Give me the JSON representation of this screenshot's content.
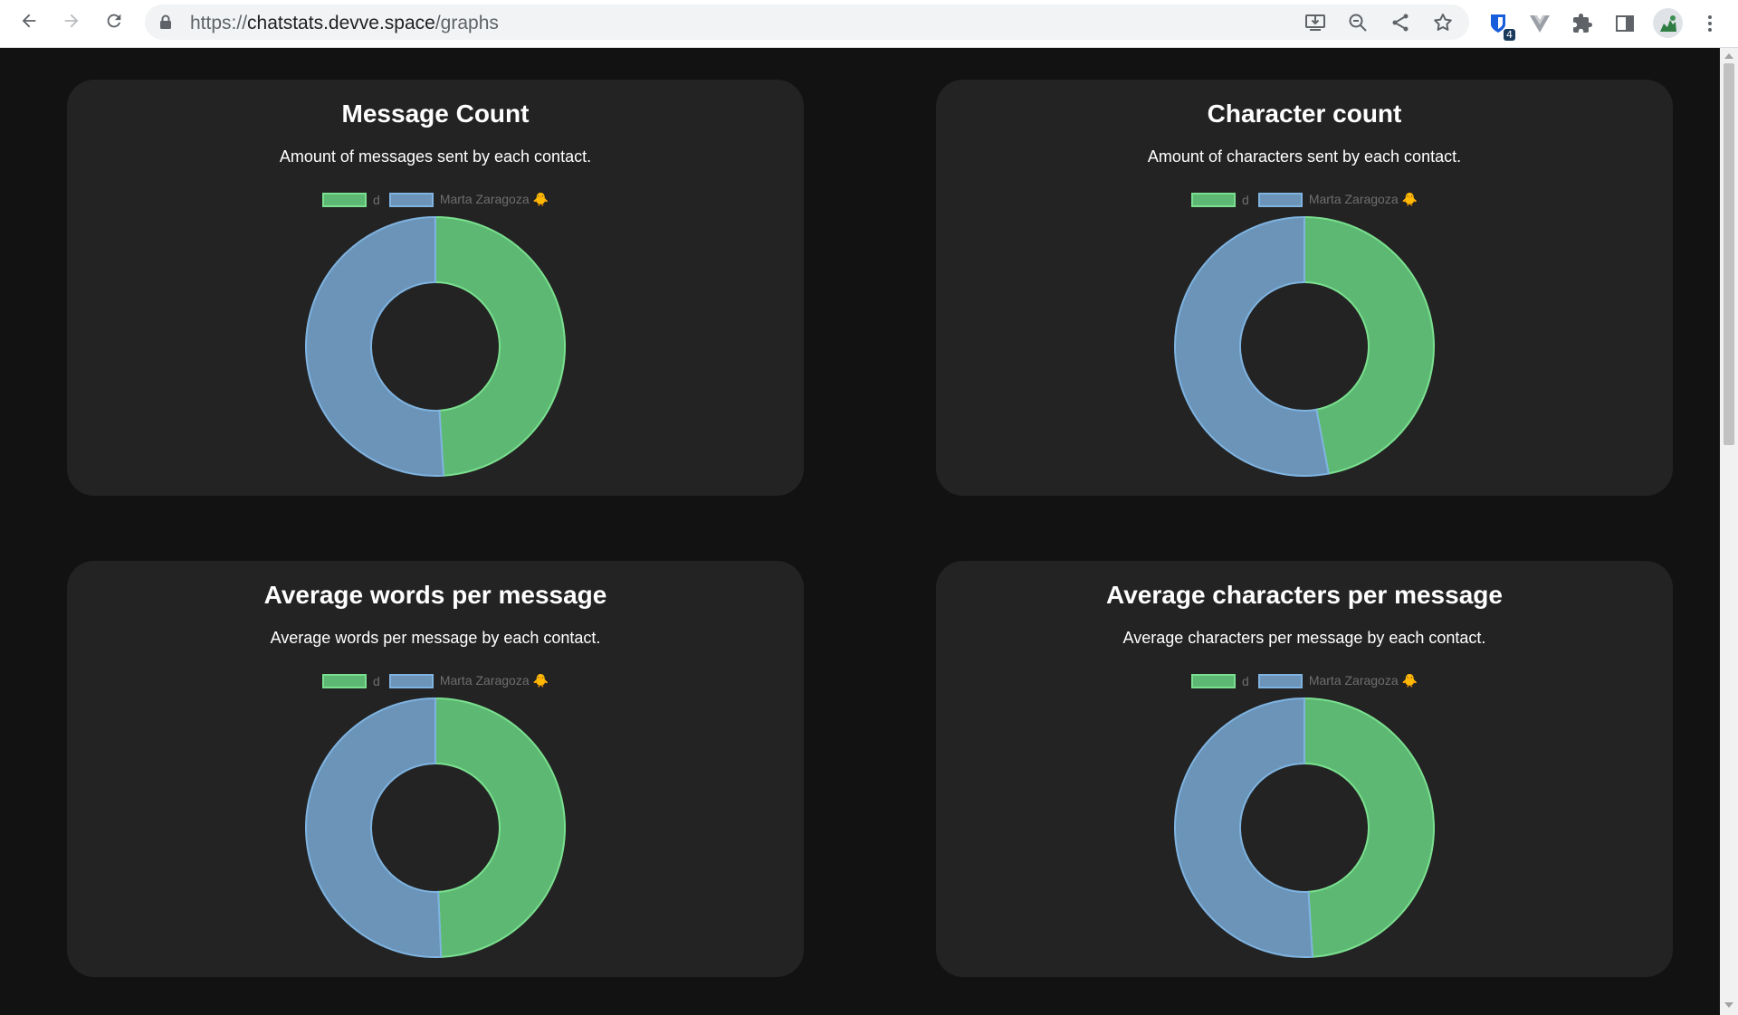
{
  "browser": {
    "url_prefix": "https://",
    "url_host": "chatstats.devve.space",
    "url_path": "/graphs",
    "extension_badge": "4"
  },
  "colors": {
    "page_bg": "#121212",
    "card_bg": "#232323",
    "series_d": "#5cb872",
    "series_d_border": "#7ae08f",
    "series_marta": "#6b94b8",
    "series_marta_border": "#7fb3e0"
  },
  "chart_data": [
    {
      "type": "pie",
      "title": "Message Count",
      "subtitle": "Amount of messages sent by each contact.",
      "donut": true,
      "legend_position": "top",
      "categories": [
        "d",
        "Marta Zaragoza 🐥"
      ],
      "values": [
        49,
        51
      ]
    },
    {
      "type": "pie",
      "title": "Character count",
      "subtitle": "Amount of characters sent by each contact.",
      "donut": true,
      "legend_position": "top",
      "categories": [
        "d",
        "Marta Zaragoza 🐥"
      ],
      "values": [
        47,
        53
      ]
    },
    {
      "type": "pie",
      "title": "Average words per message",
      "subtitle": "Average words per message by each contact.",
      "donut": true,
      "legend_position": "top",
      "categories": [
        "d",
        "Marta Zaragoza 🐥"
      ],
      "values": [
        49.3,
        50.7
      ]
    },
    {
      "type": "pie",
      "title": "Average characters per message",
      "subtitle": "Average characters per message by each contact.",
      "donut": true,
      "legend_position": "top",
      "categories": [
        "d",
        "Marta Zaragoza 🐥"
      ],
      "values": [
        49,
        51
      ]
    }
  ]
}
